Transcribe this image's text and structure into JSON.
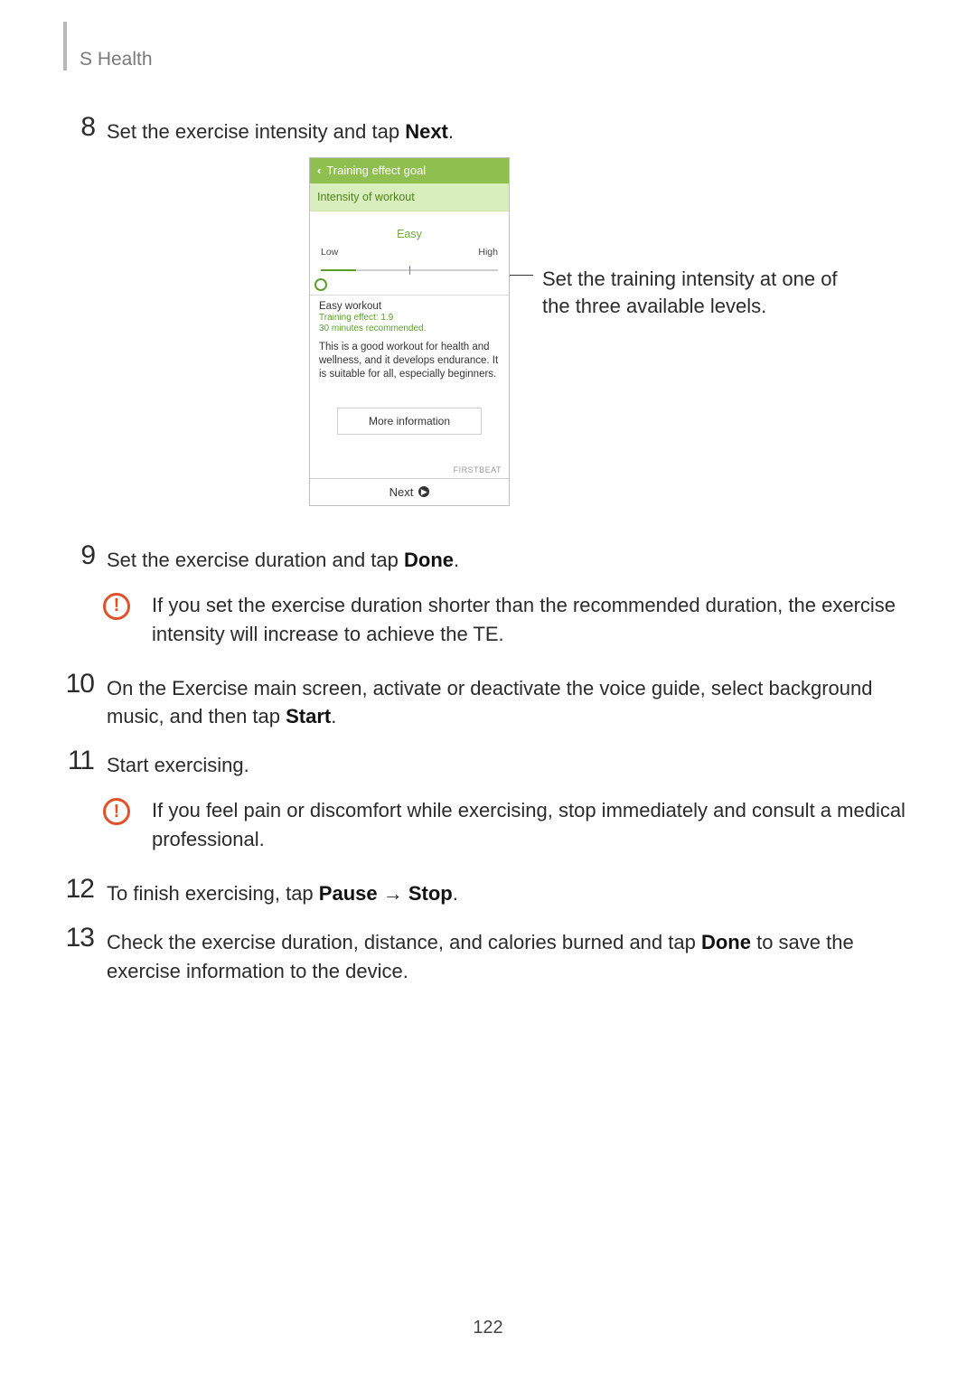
{
  "header": {
    "title": "S Health"
  },
  "steps": {
    "8": {
      "num": "8",
      "text_a": "Set the exercise intensity and tap ",
      "bold": "Next",
      "text_b": "."
    },
    "9": {
      "num": "9",
      "text_a": "Set the exercise duration and tap ",
      "bold": "Done",
      "text_b": "."
    },
    "10": {
      "num": "10",
      "text_a": "On the Exercise main screen, activate or deactivate the voice guide, select background music, and then tap ",
      "bold": "Start",
      "text_b": "."
    },
    "11": {
      "num": "11",
      "text_a": "Start exercising."
    },
    "12": {
      "num": "12",
      "text_a": "To finish exercising, tap ",
      "bold1": "Pause",
      "arrow": " → ",
      "bold2": "Stop",
      "text_b": "."
    },
    "13": {
      "num": "13",
      "text_a": "Check the exercise duration, distance, and calories burned and tap ",
      "bold": "Done",
      "text_b": " to save the exercise information to the device."
    }
  },
  "callouts": {
    "te": "If you set the exercise duration shorter than the recommended duration, the exercise intensity will increase to achieve the TE.",
    "pain": "If you feel pain or discomfort while exercising, stop immediately and consult a medical professional."
  },
  "annotation": "Set the training intensity at one of the three available levels.",
  "phone": {
    "title": "Training effect goal",
    "subtitle": "Intensity of workout",
    "level_label": "Easy",
    "low": "Low",
    "high": "High",
    "meta_title": "Easy workout",
    "meta_te": "Training effect: 1.9",
    "meta_rec": "30 minutes recommended.",
    "desc": "This is a good workout for health and wellness, and it develops endurance. It is suitable for all, especially beginners.",
    "more": "More information",
    "brand": "FIRSTBEAT",
    "next": "Next"
  },
  "page_number": "122"
}
